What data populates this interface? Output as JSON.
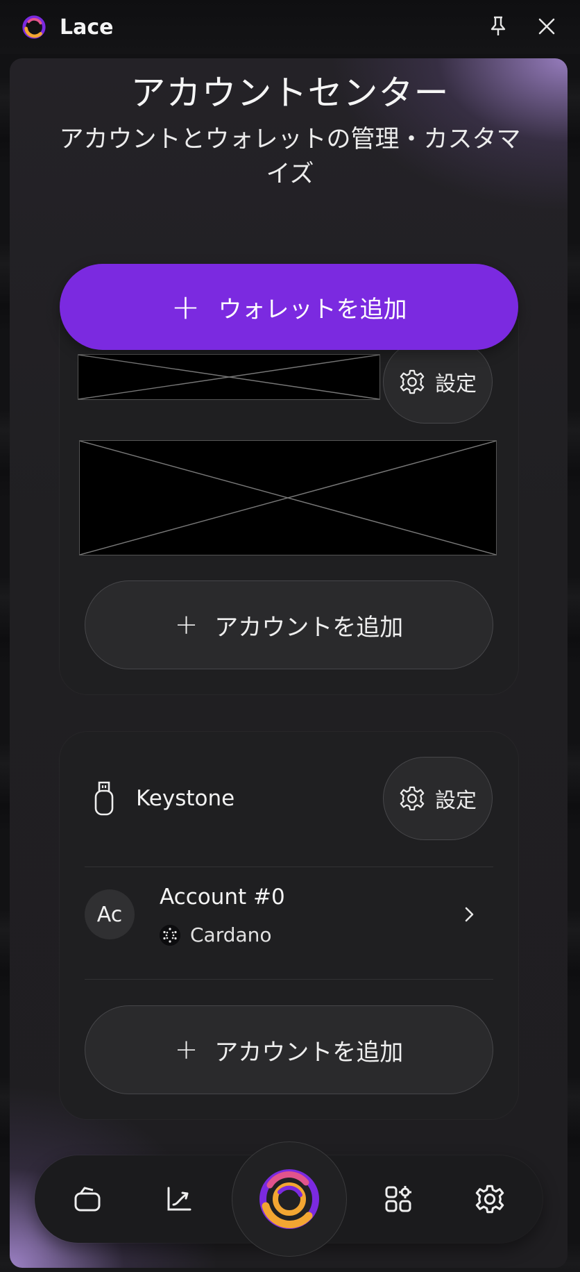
{
  "app": {
    "title": "Lace"
  },
  "page": {
    "title": "アカウントセンター",
    "subtitle": "アカウントとウォレットの管理・カスタマイズ"
  },
  "add_wallet": {
    "label": "ウォレットを追加",
    "icon": "plus-icon"
  },
  "wallet_card_1": {
    "settings_label": "設定",
    "add_account_label": "アカウントを追加"
  },
  "wallet_card_2": {
    "device_name": "Keystone",
    "device_icon": "usb-key-icon",
    "settings_label": "設定",
    "account": {
      "avatar_text": "Ac",
      "name": "Account #0",
      "network": "Cardano"
    },
    "add_account_label": "アカウントを追加"
  },
  "bottom_nav": {
    "items": [
      "wallet-icon",
      "activity-icon",
      "lace-logo",
      "apps-icon",
      "settings-icon"
    ]
  },
  "colors": {
    "accent": "#7b2ae0",
    "panel": "#1f1f21"
  }
}
